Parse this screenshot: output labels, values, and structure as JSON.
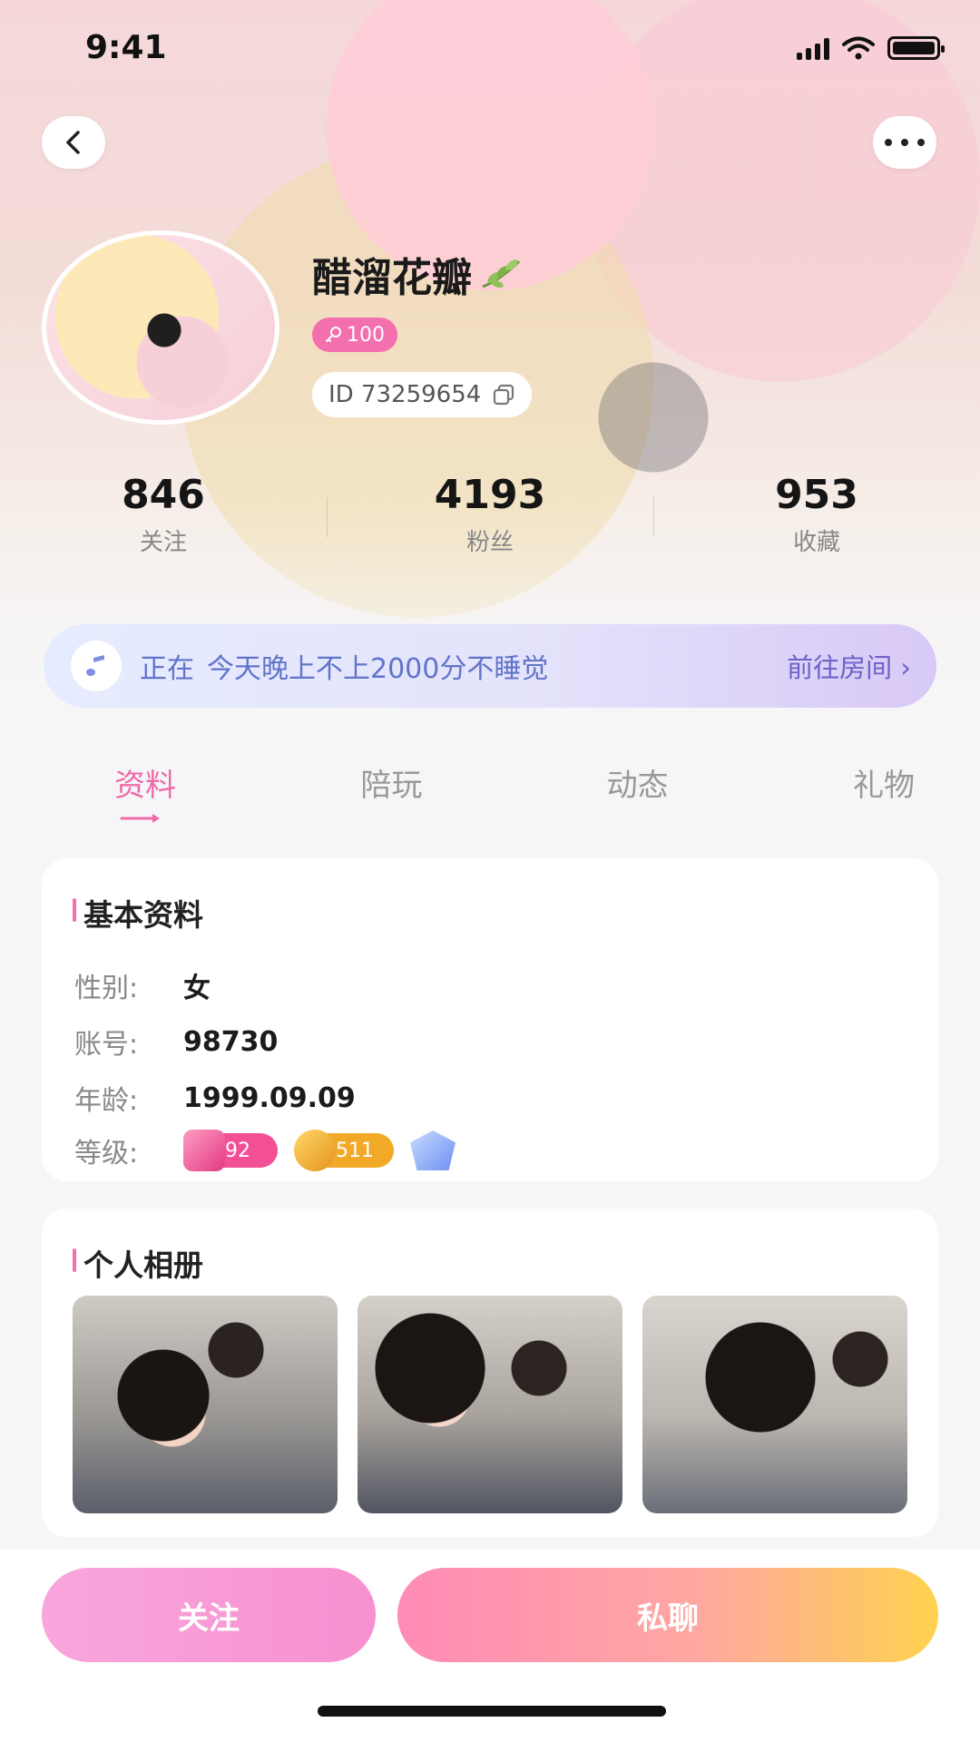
{
  "status_bar": {
    "time": "9:41"
  },
  "profile": {
    "nickname": "醋溜花瓣",
    "level": "100",
    "id_text": "ID 73259654"
  },
  "stats": [
    {
      "value": "846",
      "label": "关注"
    },
    {
      "value": "4193",
      "label": "粉丝"
    },
    {
      "value": "953",
      "label": "收藏"
    }
  ],
  "room_banner": {
    "prefix": "正在",
    "room_name": "今天晚上不上2000分不睡觉",
    "action": "前往房间 ›"
  },
  "tabs": [
    "资料",
    "陪玩",
    "动态",
    "礼物"
  ],
  "active_tab": "资料",
  "basic_info": {
    "title": "基本资料",
    "gender_label": "性别:",
    "gender": "女",
    "account_label": "账号:",
    "account": "98730",
    "age_label": "年龄:",
    "age": "1999.09.09",
    "level_label": "等级:",
    "badge_pink": "92",
    "badge_gold": "511"
  },
  "album": {
    "title": "个人相册"
  },
  "actions": {
    "follow": "关注",
    "chat": "私聊"
  },
  "colors": {
    "accent_pink": "#f06aa8",
    "room_text": "#6174c9",
    "badge_pink": "#f24f95",
    "badge_gold": "#f2a928"
  }
}
